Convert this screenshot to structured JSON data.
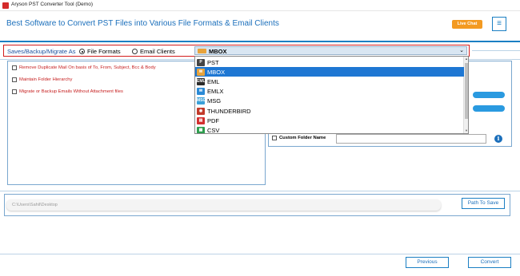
{
  "window": {
    "title": "Aryson PST Converter Tool (Demo)"
  },
  "header": {
    "headline": "Best Software to Convert PST Files into Various File Formats & Email Clients",
    "live_chat": "Live Chat",
    "menu_glyph": "≡"
  },
  "save_row": {
    "label": "Saves/Backup/Migrate As",
    "radio_file_formats": "File Formats",
    "radio_email_clients": "Email Clients",
    "selected_radio": "File Formats",
    "selected_format": "MBOX",
    "dropdown_arrow": "⌄"
  },
  "format_list": {
    "items": [
      {
        "label": "PST",
        "icon": "pst-icon",
        "color": "#444444",
        "glyph": "P"
      },
      {
        "label": "MBOX",
        "icon": "mbox-icon",
        "color": "#e8a33b",
        "glyph": "✉"
      },
      {
        "label": "EML",
        "icon": "eml-icon",
        "color": "#2b2b2b",
        "glyph": "EML"
      },
      {
        "label": "EMLX",
        "icon": "emlx-icon",
        "color": "#2a8ad6",
        "glyph": "✉"
      },
      {
        "label": "MSG",
        "icon": "msg-icon",
        "color": "#3aa0d8",
        "glyph": "MSG"
      },
      {
        "label": "THUNDERBIRD",
        "icon": "thunderbird-icon",
        "color": "#c23a2a",
        "glyph": "◉"
      },
      {
        "label": "PDF",
        "icon": "pdf-icon",
        "color": "#d32f2f",
        "glyph": "▤"
      },
      {
        "label": "CSV",
        "icon": "csv-icon",
        "color": "#2e9e4e",
        "glyph": "▦"
      }
    ],
    "selected_index": 1
  },
  "options": {
    "remove_duplicates": "Remove Duplicate Mail On basis of To, From, Subject, Bcc & Body",
    "maintain_hierarchy": "Maintain Folder Hierarchy",
    "migrate_without_attachments": "Migrate or Backup Emails Without Attachment files"
  },
  "custom_folder": {
    "label": "Custom Folder Name",
    "value": ""
  },
  "destination": {
    "path": "C:\\Users\\Sahil\\Desktop",
    "path_button": "Path To Save"
  },
  "footer": {
    "previous": "Previous",
    "convert": "Convert"
  }
}
